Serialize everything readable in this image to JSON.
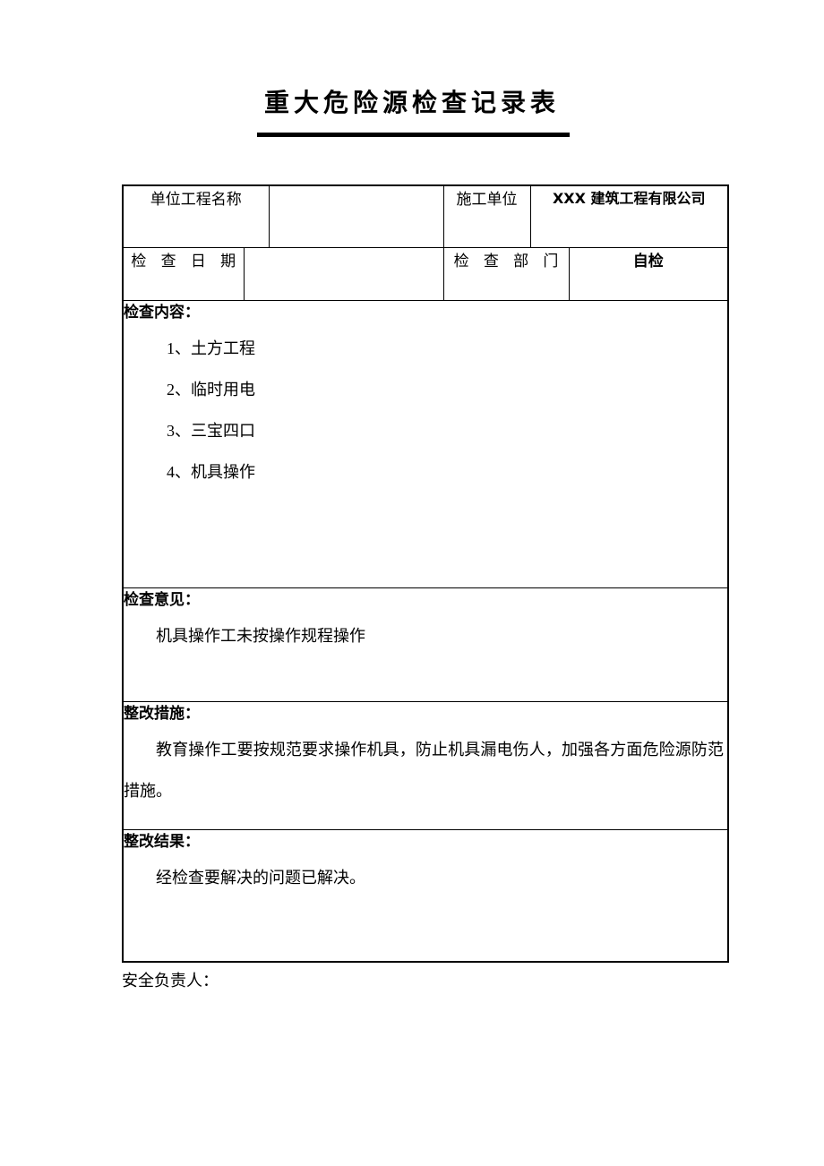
{
  "document": {
    "title": "重大危险源检查记录表"
  },
  "table": {
    "row_project": {
      "label": "单位工程名称",
      "value": "",
      "label2": "施工单位",
      "value2": "XXX 建筑工程有限公司"
    },
    "row_date": {
      "label": "检 查 日 期",
      "value": "",
      "label2": "检 查 部 门",
      "value2": "自检"
    },
    "section_content": {
      "title": "检查内容：",
      "items": [
        "1、土方工程",
        "2、临时用电",
        "3、三宝四口",
        "4、机具操作"
      ]
    },
    "section_opinion": {
      "title": "检查意见：",
      "body": "机具操作工未按操作规程操作"
    },
    "section_measures": {
      "title": "整改措施：",
      "body": "教育操作工要按规范要求操作机具，防止机具漏电伤人，加强各方面危险源防范措施。"
    },
    "section_result": {
      "title": "整改结果：",
      "body": "经检查要解决的问题已解决。"
    }
  },
  "footer": {
    "signature_label": "安全负责人："
  },
  "colors": {
    "text": "#000000",
    "border": "#000000",
    "background": "#ffffff"
  }
}
